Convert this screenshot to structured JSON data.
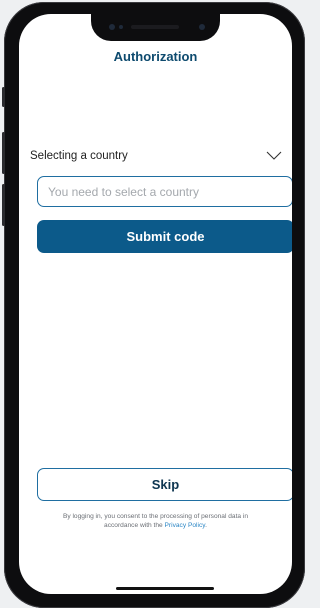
{
  "header": {
    "title": "Authorization"
  },
  "country_select": {
    "label": "Selecting a country"
  },
  "input": {
    "placeholder": "You need to select a country"
  },
  "submit": {
    "label": "Submit code"
  },
  "skip": {
    "label": "Skip"
  },
  "consent": {
    "text_line1": "By logging in, you consent to the processing of personal data in",
    "text_line2_prefix": "accordance with the ",
    "link": "Privacy Policy",
    "text_suffix": "."
  },
  "icons": {
    "country_chevron": "chevron-down-icon"
  },
  "colors": {
    "brand": "#0c5a8a",
    "title": "#0d4a6e",
    "link": "#2b86c5",
    "input_border": "#1f6ea1"
  }
}
